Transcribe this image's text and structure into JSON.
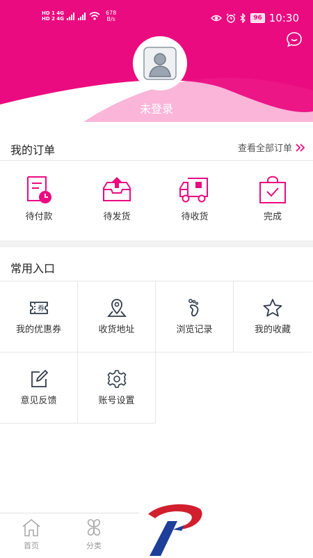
{
  "status_bar": {
    "net_line1": "HD 1 4G",
    "net_line2": "HD 2 4G",
    "speed_value": "678",
    "speed_unit": "B/s",
    "battery": "96",
    "time": "10:30"
  },
  "profile": {
    "login_label": "未登录"
  },
  "orders": {
    "title": "我的订单",
    "view_all_label": "查看全部订单",
    "items": [
      {
        "label": "待付款",
        "icon": "pending-payment-icon"
      },
      {
        "label": "待发货",
        "icon": "pending-shipment-icon"
      },
      {
        "label": "待收货",
        "icon": "delivery-truck-icon"
      },
      {
        "label": "完成",
        "icon": "completed-bag-icon"
      }
    ]
  },
  "common": {
    "title": "常用入口",
    "items": [
      {
        "label": "我的优惠券",
        "icon": "coupon-icon"
      },
      {
        "label": "收货地址",
        "icon": "location-icon"
      },
      {
        "label": "浏览记录",
        "icon": "footprint-icon"
      },
      {
        "label": "我的收藏",
        "icon": "star-icon"
      },
      {
        "label": "意见反馈",
        "icon": "edit-feedback-icon"
      },
      {
        "label": "账号设置",
        "icon": "settings-gear-icon"
      }
    ]
  },
  "tabbar": {
    "items": [
      {
        "label": "首页",
        "icon": "home-icon"
      },
      {
        "label": "分类",
        "icon": "category-icon"
      }
    ]
  },
  "colors": {
    "brand": "#ea0b80",
    "icon_gray": "#2f3a4a"
  }
}
